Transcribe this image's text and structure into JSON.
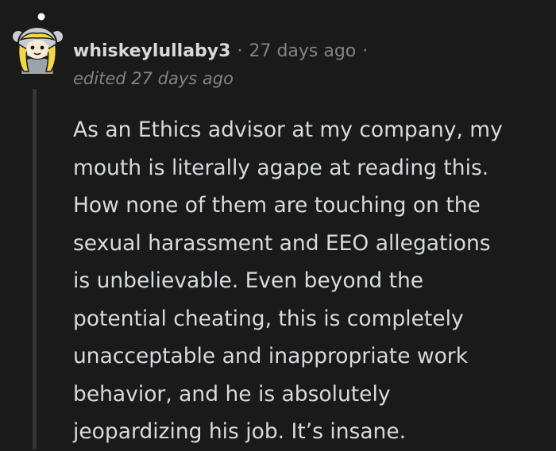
{
  "comment": {
    "author": "whiskeylullaby3",
    "separator": "·",
    "time": "27 days ago",
    "edited": "edited 27 days ago",
    "body_lines": [
      "As an Ethics advisor at my company, my",
      "mouth is literally agape at reading this.",
      "How none of them are touching on the",
      "sexual harassment and EEO allegations",
      "is unbelievable. Even beyond the",
      "potential cheating, this is completely",
      "unacceptable and inappropriate work",
      "behavior, and he is absolutely",
      "jeopardizing his job. It’s insane."
    ]
  },
  "colors": {
    "background": "#1a1a1b",
    "text": "#d7dadc",
    "meta": "#818384",
    "thread_line": "#343536"
  },
  "icons": {
    "avatar": "snoo-avatar-icon"
  }
}
